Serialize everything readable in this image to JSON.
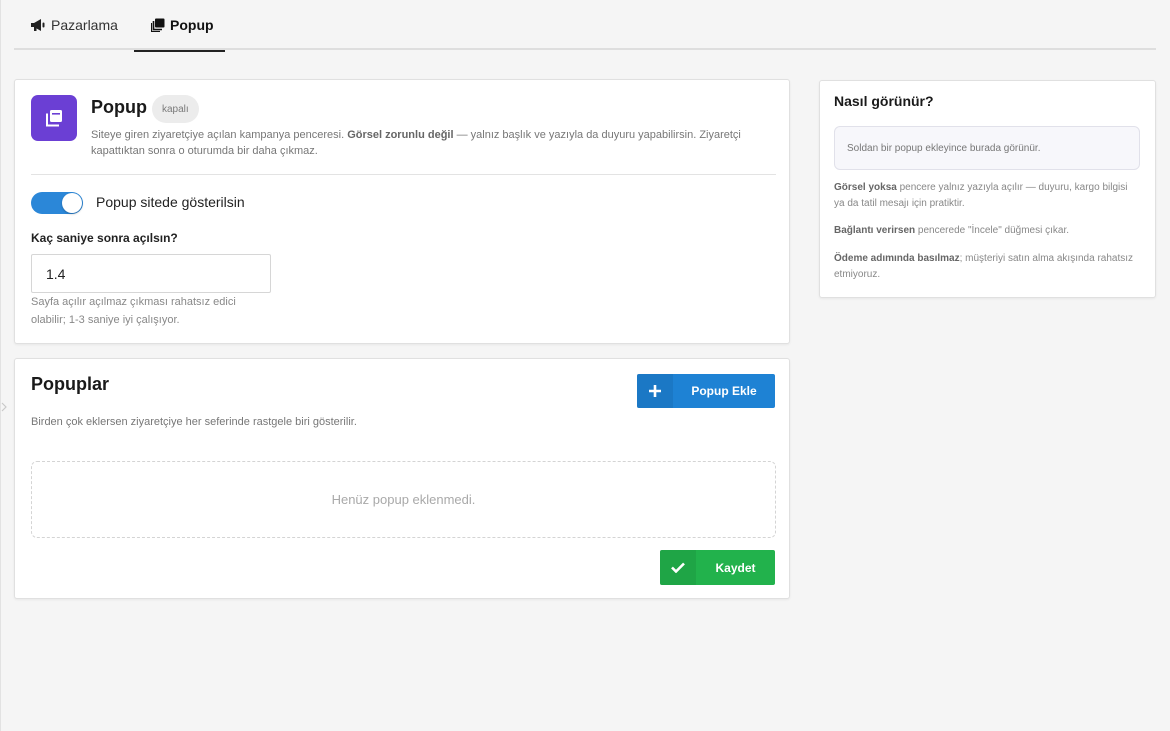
{
  "tabs": [
    {
      "label": "Pazarlama",
      "icon": "megaphone-icon",
      "active": false
    },
    {
      "label": "Popup",
      "icon": "popup-icon",
      "active": true
    }
  ],
  "popup_settings": {
    "title": "Popup",
    "status_badge": "kapalı",
    "description_part1": "Siteye giren ziyaretçiye açılan kampanya penceresi. ",
    "description_bold": "Görsel zorunlu değil",
    "description_part2": " — yalnız başlık ve yazıyla da duyuru yapabilirsin. Ziyaretçi kapattıktan sonra o oturumda bir daha çıkmaz.",
    "toggle_label": "Popup sitede gösterilsin",
    "toggle_on": true,
    "delay_label": "Kaç saniye sonra açılsın?",
    "delay_value": "1.4",
    "delay_hint": "Sayfa açılır açılmaz çıkması rahatsız edici olabilir; 1-3 saniye iyi çalışıyor."
  },
  "popups_list": {
    "title": "Popuplar",
    "add_button": "Popup Ekle",
    "description": "Birden çok eklersen ziyaretçiye her seferinde rastgele biri gösterilir.",
    "empty_text": "Henüz popup eklenmedi.",
    "save_button": "Kaydet"
  },
  "sidebar": {
    "title": "Nasıl görünür?",
    "preview_placeholder": "Soldan bir popup ekleyince burada görünür.",
    "notes": [
      {
        "bold": "Görsel yoksa",
        "text": " pencere yalnız yazıyla açılır — duyuru, kargo bilgisi ya da tatil mesajı için pratiktir."
      },
      {
        "bold": "Bağlantı verirsen",
        "text": " pencerede \"İncele\" düğmesi çıkar."
      },
      {
        "bold": "Ödeme adımında basılmaz",
        "text": "; müşteriyi satın alma akışında rahatsız etmiyoruz."
      }
    ]
  },
  "colors": {
    "accent_blue": "#1e82d4",
    "toggle_blue": "#2b87d8",
    "icon_purple": "#6b3fd4",
    "save_green": "#22b24c"
  }
}
